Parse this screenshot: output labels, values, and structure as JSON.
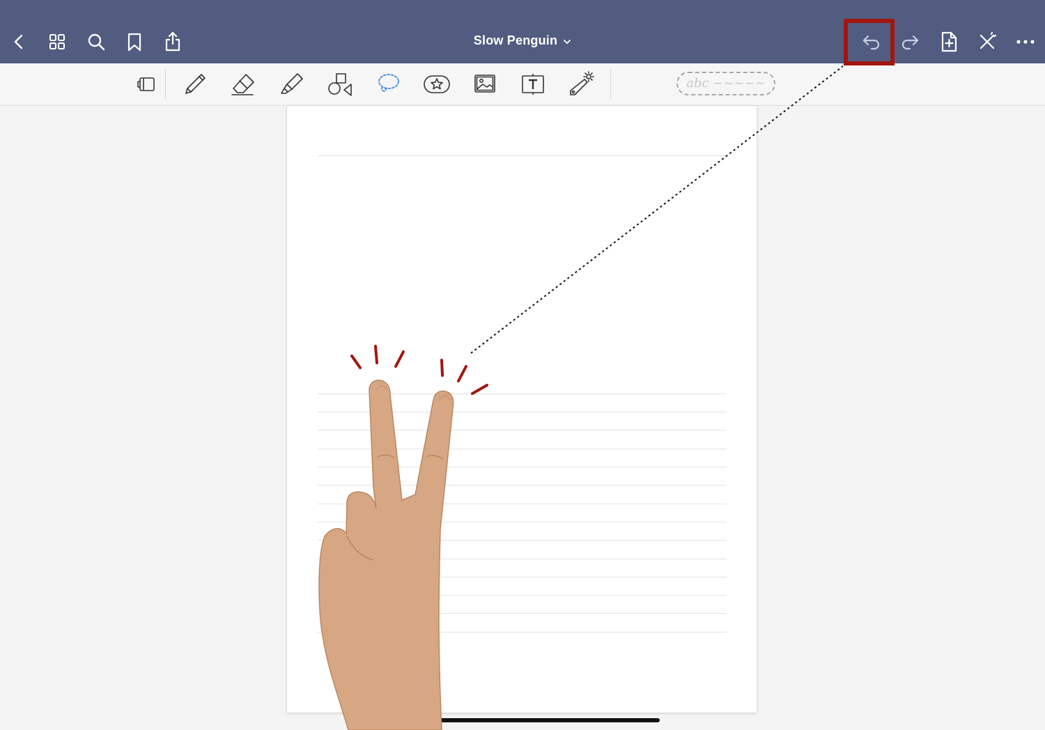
{
  "header": {
    "title": "Slow Penguin",
    "bg_color": "#525c80"
  },
  "nav_icons": [
    "back-chevron-icon",
    "grid-icon",
    "search-icon",
    "bookmark-icon",
    "share-icon"
  ],
  "action_icons": [
    "undo-icon",
    "redo-icon",
    "add-page-icon",
    "close-toolbar-icon",
    "more-icon"
  ],
  "toolbar": {
    "tools": [
      "page-view-icon",
      "pen-icon",
      "eraser-icon",
      "highlighter-icon",
      "shapes-icon",
      "lasso-icon",
      "sticker-icon",
      "image-icon",
      "text-box-icon",
      "laser-pointer-icon"
    ],
    "handwriting_pill": "abc ~~~~~"
  },
  "annotation": {
    "highlight_color": "#a3160f",
    "gesture": "two-finger-tap"
  }
}
